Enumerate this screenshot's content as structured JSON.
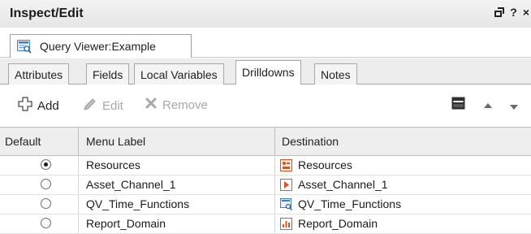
{
  "window": {
    "title": "Inspect/Edit",
    "controls": {
      "restore_icon": "window-restore-icon",
      "help_label": "?",
      "close_label": "×"
    }
  },
  "document_tab": {
    "label": "Query Viewer:Example",
    "icon": "query-viewer-icon"
  },
  "section_tabs": [
    {
      "label": "Attributes",
      "active": false
    },
    {
      "label": "Fields",
      "active": false
    },
    {
      "label": "Local Variables",
      "active": false
    },
    {
      "label": "Drilldowns",
      "active": true
    },
    {
      "label": "Notes",
      "active": false
    }
  ],
  "toolbar": {
    "add_label": "Add",
    "edit_label": "Edit",
    "remove_label": "Remove",
    "add_icon": "add-icon",
    "edit_icon": "pencil-icon",
    "remove_icon": "remove-icon",
    "right_icons": [
      "table-view-icon",
      "move-up-icon",
      "move-down-icon"
    ]
  },
  "table": {
    "columns": [
      "Default",
      "Menu Label",
      "Destination"
    ],
    "rows": [
      {
        "default": true,
        "menu_label": "Resources",
        "destination": "Resources",
        "dest_icon": "resources-icon"
      },
      {
        "default": false,
        "menu_label": "Asset_Channel_1",
        "destination": "Asset_Channel_1",
        "dest_icon": "channel-icon"
      },
      {
        "default": false,
        "menu_label": "QV_Time_Functions",
        "destination": "QV_Time_Functions",
        "dest_icon": "query-viewer-icon"
      },
      {
        "default": false,
        "menu_label": "Report_Domain",
        "destination": "Report_Domain",
        "dest_icon": "report-icon"
      }
    ]
  },
  "colors": {
    "tab_border": "#a8a8a8",
    "header_bg": "#eeeeee",
    "disabled_text": "#a8a8a8",
    "resources_icon": "#d9541e",
    "channel_icon": "#d9541e",
    "report_icon": "#d9541e",
    "qv_icon": "#3d7fc1"
  }
}
